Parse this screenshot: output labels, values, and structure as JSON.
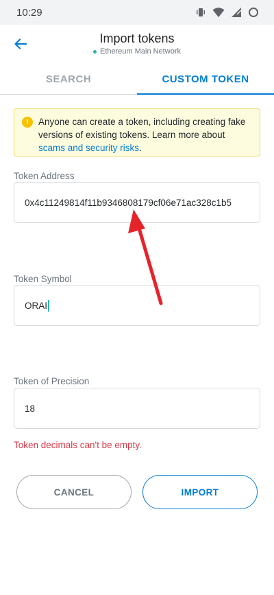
{
  "status_bar": {
    "time": "10:29",
    "icons": [
      "vibrate-icon",
      "wifi-icon",
      "cell-signal-icon",
      "battery-icon"
    ]
  },
  "header": {
    "title": "Import tokens",
    "network": "Ethereum Main Network",
    "back_icon": "arrow-left-icon"
  },
  "tabs": [
    {
      "label": "SEARCH",
      "active": false
    },
    {
      "label": "CUSTOM TOKEN",
      "active": true
    }
  ],
  "warning": {
    "text": "Anyone can create a token, including creating fake versions of existing tokens. Learn more about ",
    "link_text": "scams and security risks",
    "suffix": "."
  },
  "fields": {
    "address": {
      "label": "Token Address",
      "value": "0x4c11249814f11b9346808179cf06e71ac328c1b5"
    },
    "symbol": {
      "label": "Token Symbol",
      "value": "ORAI"
    },
    "precision": {
      "label": "Token of Precision",
      "value": "18"
    }
  },
  "error": "Token decimals can't be empty.",
  "buttons": {
    "cancel": "CANCEL",
    "import": "IMPORT"
  },
  "colors": {
    "accent": "#037dd6",
    "warning_bg": "#fefcde",
    "error": "#d73a49",
    "annotation_arrow": "#e5232a"
  }
}
